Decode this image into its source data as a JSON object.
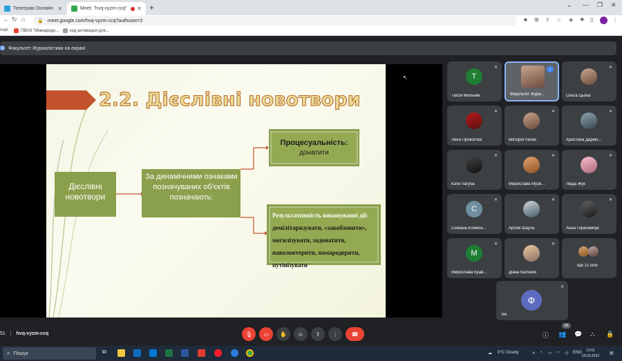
{
  "browser": {
    "tabs": [
      {
        "title": "Телеграм Онлайн",
        "color": "#2aa3dd"
      },
      {
        "title": "Meet: \"hvq-vyzm-ccq\"",
        "color": "#34a853"
      }
    ],
    "new_tab_label": "+",
    "url": "meet.google.com/hvq-vyzm-ccq?authuser=2",
    "bookmarks": [
      "mail",
      "ПВНЗ \"Міжнародн...",
      "код активации для..."
    ]
  },
  "meet": {
    "presenting_label": "Факультет Журналістики на екрані",
    "meeting_code": "hvq-vyzm-ccq",
    "time_fragment": "51",
    "participants_count": "26",
    "slide": {
      "title": "2.2. Дієслівні новотвори",
      "box_left": "Дієслівні новотвори",
      "box_middle": "За динамічними ознаками позначуваних об'єктів позначають:",
      "box_top_heading": "Процесуальність:",
      "box_top_example": "донатити",
      "box_bottom_heading": "Результативність виконуваної дії:",
      "box_bottom_text": "демілітаризувати, «закобзонити», могилізувати, задонатити, наволонтерити, намародерити, путінізувати"
    },
    "participants": [
      {
        "name": "Таїсія Мельник",
        "initial": "Т",
        "color": "#1e7e34"
      },
      {
        "name": "Факультет Журн...",
        "initial": "",
        "color": ""
      },
      {
        "name": "Ольга Цьока",
        "initial": "",
        "color": ""
      },
      {
        "name": "Лена Прокоп'юк",
        "initial": "",
        "color": ""
      },
      {
        "name": "Вікторія Лисик",
        "initial": "",
        "color": ""
      },
      {
        "name": "Христина Дармо...",
        "initial": "",
        "color": ""
      },
      {
        "name": "Юля Пагуба",
        "initial": "",
        "color": ""
      },
      {
        "name": "Мирослава Музи...",
        "initial": "",
        "color": ""
      },
      {
        "name": "Люда Жук",
        "initial": "",
        "color": ""
      },
      {
        "name": "Сніжана Климон...",
        "initial": "С",
        "color": "#6f8fa0"
      },
      {
        "name": "Артем Шаула",
        "initial": "",
        "color": ""
      },
      {
        "name": "Анна Герасимчук",
        "initial": "",
        "color": ""
      },
      {
        "name": "Мирослава Крав...",
        "initial": "М",
        "color": "#1e7e34"
      },
      {
        "name": "Діана Калоник",
        "initial": "",
        "color": ""
      },
      {
        "name": "Ще 11 осіб",
        "initial": "",
        "color": ""
      }
    ],
    "self_tile": {
      "name": "Ви",
      "initial": "Ф",
      "color": "#5c6bc0"
    }
  },
  "taskbar": {
    "search_placeholder": "Пошук",
    "weather": "0°C  Cloudy",
    "language": "ENG",
    "time": "13:51",
    "date": "29.03.2023"
  }
}
